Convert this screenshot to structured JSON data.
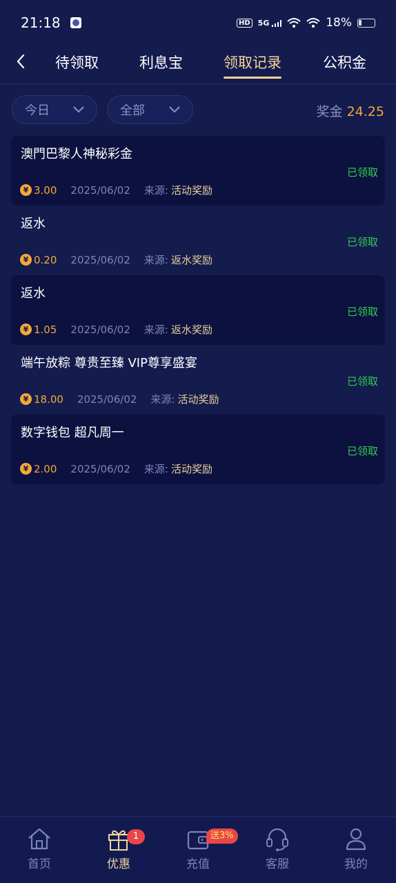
{
  "status_bar": {
    "time": "21:18",
    "network": "5G",
    "battery": "18%",
    "hd": "HD"
  },
  "tabs": [
    {
      "label": "待领取",
      "active": false
    },
    {
      "label": "利息宝",
      "active": false
    },
    {
      "label": "领取记录",
      "active": true
    },
    {
      "label": "公积金",
      "active": false
    }
  ],
  "filters": {
    "date": "今日",
    "type": "全部"
  },
  "bonus": {
    "label": "奖金",
    "value": "24.25"
  },
  "records": [
    {
      "title": "澳門巴黎人神秘彩金",
      "status": "已领取",
      "amount": "3.00",
      "date": "2025/06/02",
      "source_label": "来源:",
      "source": "活动奖励"
    },
    {
      "title": "返水",
      "status": "已领取",
      "amount": "0.20",
      "date": "2025/06/02",
      "source_label": "来源:",
      "source": "返水奖励"
    },
    {
      "title": "返水",
      "status": "已领取",
      "amount": "1.05",
      "date": "2025/06/02",
      "source_label": "来源:",
      "source": "返水奖励"
    },
    {
      "title": "端午放粽 尊贵至臻  VIP尊享盛宴",
      "status": "已领取",
      "amount": "18.00",
      "date": "2025/06/02",
      "source_label": "来源:",
      "source": "活动奖励"
    },
    {
      "title": "数字钱包 超凡周一",
      "status": "已领取",
      "amount": "2.00",
      "date": "2025/06/02",
      "source_label": "来源:",
      "source": "活动奖励"
    }
  ],
  "coin_symbol": "¥",
  "bottom_nav": [
    {
      "label": "首页",
      "icon": "home-icon",
      "active": false
    },
    {
      "label": "优惠",
      "icon": "gift-icon",
      "active": true,
      "badge": "1"
    },
    {
      "label": "充值",
      "icon": "wallet-icon",
      "active": false,
      "badge": "送3%"
    },
    {
      "label": "客服",
      "icon": "headset-icon",
      "active": false
    },
    {
      "label": "我的",
      "icon": "user-icon",
      "active": false
    }
  ],
  "colors": {
    "background": "#141b4d",
    "accent_gold": "#f2d59a",
    "amount_orange": "#f2a83a",
    "status_green": "#2fcf4a",
    "badge_red": "#e94747"
  }
}
